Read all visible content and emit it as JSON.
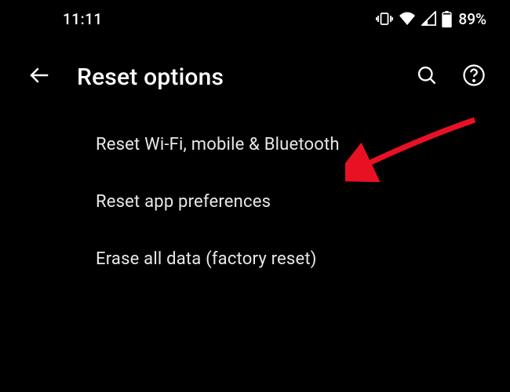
{
  "status_bar": {
    "time": "11:11",
    "battery_percent": "89%"
  },
  "header": {
    "title": "Reset options"
  },
  "options": [
    {
      "label": "Reset Wi-Fi, mobile & Bluetooth"
    },
    {
      "label": "Reset app preferences"
    },
    {
      "label": "Erase all data (factory reset)"
    }
  ]
}
